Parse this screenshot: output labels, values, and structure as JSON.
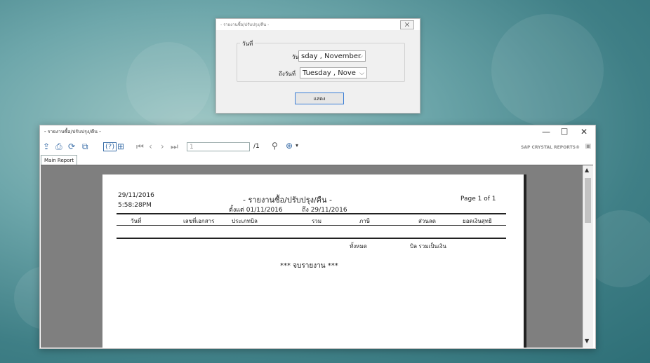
{
  "dialog": {
    "title": "- รายงานซื้อ/ปรับปรุง/คืน -",
    "close_label": "⨉",
    "group_label": "วันที่",
    "from_label": "วันที่",
    "from_value": "sday   , November",
    "to_label": "ถึงวันที่",
    "to_value": "Tuesday   , Nove",
    "show_button": "แสดง"
  },
  "window": {
    "title": "- รายงานซื้อ/ปรับปรุง/คืน -",
    "minimize": "—",
    "maximize": "☐",
    "close": "✕"
  },
  "toolbar": {
    "page_input": "1",
    "page_total": "/1",
    "brand": "SAP CRYSTAL REPORTS®"
  },
  "tabs": [
    "Main Report"
  ],
  "report": {
    "date": "29/11/2016",
    "time": "5:58:28PM",
    "title": "- รายงานซื้อ/ปรับปรุง/คืน -",
    "range_from": "ตั้งแต่ 01/11/2016",
    "range_to": "ถึง 29/11/2016",
    "page": "Page 1 of 1",
    "columns": [
      "วันที่",
      "เลขที่เอกสาร",
      "ประเภทบิล",
      "รวม",
      "ภาษี",
      "ส่วนลด",
      "ยอดเงินสุทธิ"
    ],
    "total_label": "ทั้งหมด",
    "total_bills": "บิล รวมเป็นเงิน",
    "end_label": "*** จบรายงาน ***"
  }
}
